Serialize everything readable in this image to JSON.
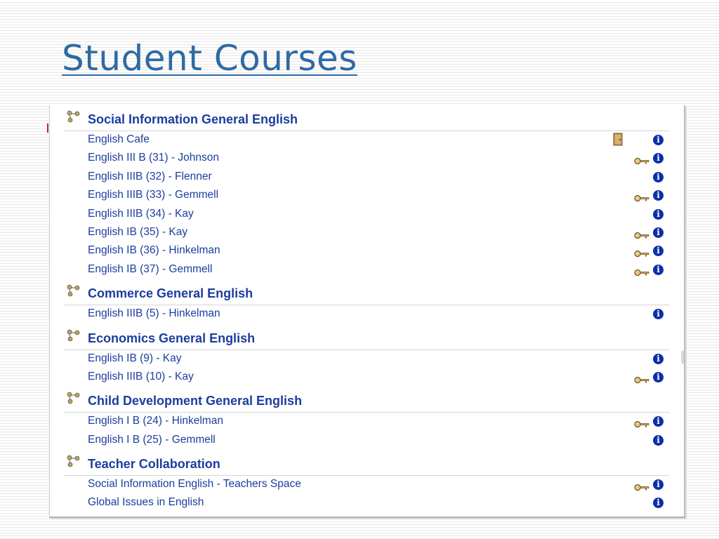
{
  "slide": {
    "title": "Student Courses"
  },
  "colors": {
    "title": "#2f6aa3",
    "link": "#1b3d9e",
    "info_icon": "#0a2fa8",
    "key_icon": "#c8a064"
  },
  "categories": [
    {
      "name": "Social Information General English",
      "icon": "category-icon",
      "courses": [
        {
          "name": "English Cafe",
          "guest_key": false,
          "door": true,
          "info": true
        },
        {
          "name": "English III B (31) - Johnson",
          "guest_key": true,
          "door": false,
          "info": true
        },
        {
          "name": "English IIIB (32) - Flenner",
          "guest_key": false,
          "door": false,
          "info": true
        },
        {
          "name": "English IIIB (33) - Gemmell",
          "guest_key": true,
          "door": false,
          "info": true
        },
        {
          "name": "English IIIB (34) - Kay",
          "guest_key": false,
          "door": false,
          "info": true
        },
        {
          "name": "English IB (35) - Kay",
          "guest_key": true,
          "door": false,
          "info": true
        },
        {
          "name": "English IB (36) - Hinkelman",
          "guest_key": true,
          "door": false,
          "info": true
        },
        {
          "name": "English IB (37) - Gemmell",
          "guest_key": true,
          "door": false,
          "info": true
        }
      ]
    },
    {
      "name": "Commerce General English",
      "icon": "category-icon",
      "courses": [
        {
          "name": "English IIIB (5) - Hinkelman",
          "guest_key": false,
          "door": false,
          "info": true
        }
      ]
    },
    {
      "name": "Economics General English",
      "icon": "category-icon",
      "courses": [
        {
          "name": "English IB (9) - Kay",
          "guest_key": false,
          "door": false,
          "info": true
        },
        {
          "name": "English IIIB (10) - Kay",
          "guest_key": true,
          "door": false,
          "info": true
        }
      ]
    },
    {
      "name": "Child Development General English",
      "icon": "category-icon",
      "courses": [
        {
          "name": "English I B (24) - Hinkelman",
          "guest_key": true,
          "door": false,
          "info": true
        },
        {
          "name": "English I B (25) - Gemmell",
          "guest_key": false,
          "door": false,
          "info": true
        }
      ]
    },
    {
      "name": "Teacher Collaboration",
      "icon": "category-icon",
      "courses": [
        {
          "name": "Social Information English - Teachers Space",
          "guest_key": true,
          "door": false,
          "info": true
        },
        {
          "name": "Global Issues in English",
          "guest_key": false,
          "door": false,
          "info": true
        }
      ]
    }
  ]
}
